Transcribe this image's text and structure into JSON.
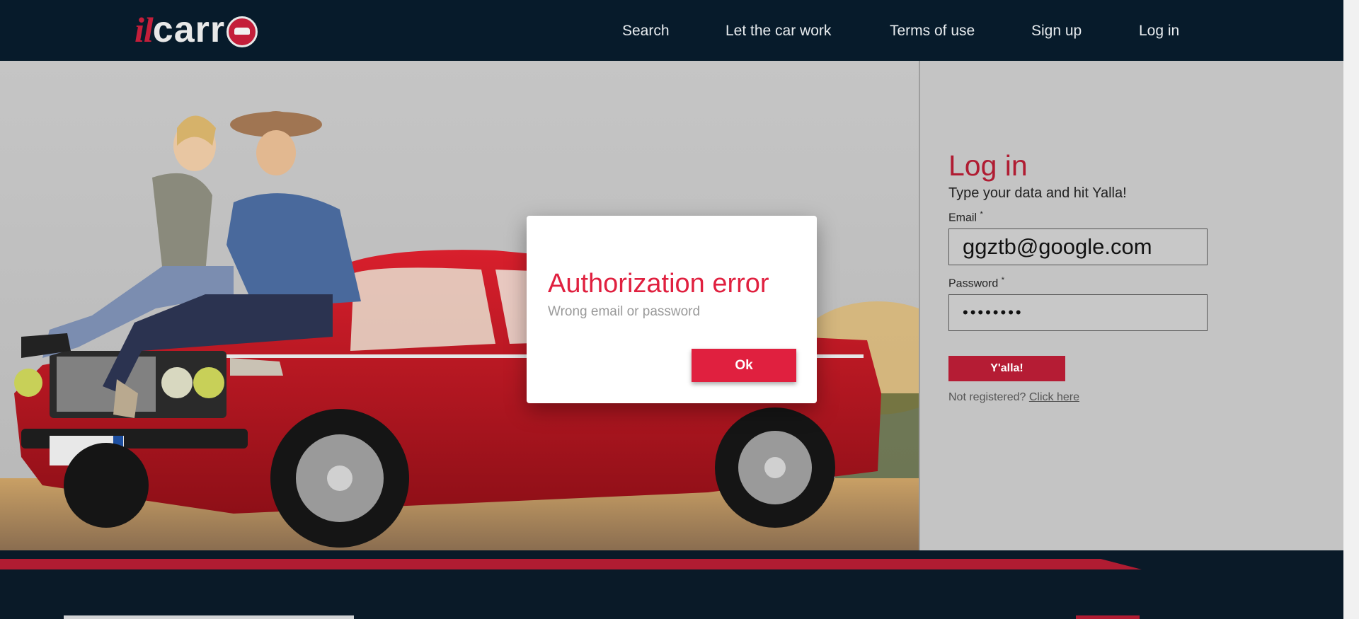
{
  "brand": {
    "prefix": "il",
    "name": "carr",
    "logo_icon": "car-in-circle-icon"
  },
  "nav": {
    "items": [
      {
        "label": "Search"
      },
      {
        "label": "Let the car work"
      },
      {
        "label": "Terms of use"
      },
      {
        "label": "Sign up"
      },
      {
        "label": "Log in"
      }
    ]
  },
  "login": {
    "title": "Log in",
    "subtitle": "Type your data and hit Yalla!",
    "email_label": "Email",
    "email_value": "ggztb@google.com",
    "password_label": "Password",
    "password_value": "••••••••",
    "required_mark": "*",
    "submit_label": "Y'alla!",
    "not_registered": "Not registered?",
    "click_here": "Click here"
  },
  "dialog": {
    "title": "Authorization error",
    "message": "Wrong email or password",
    "ok_label": "Ok"
  },
  "colors": {
    "header_bg": "#071b2b",
    "accent": "#b01c32",
    "dialog_accent": "#e0203f",
    "panel_bg": "#c4c4c4"
  }
}
